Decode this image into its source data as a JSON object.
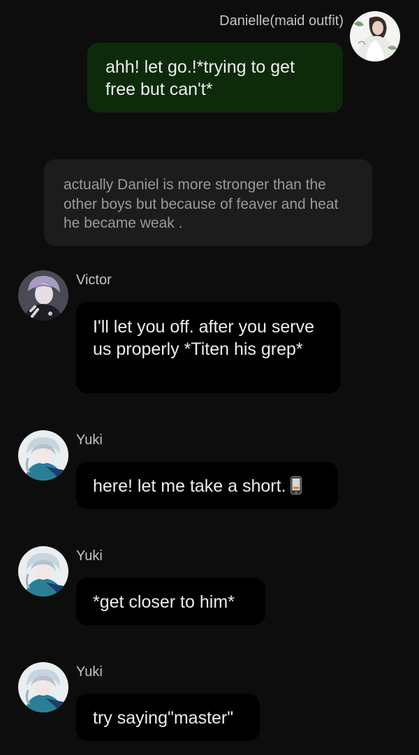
{
  "messages": [
    {
      "sender": "Danielle(maid outfit)",
      "text": "ahh! let go.!*trying to get free but can't*",
      "avatar_icon": "danielle-avatar"
    },
    {
      "type": "narration",
      "text": "actually Daniel is more stronger than the other boys but because of feaver and heat  he became weak ."
    },
    {
      "sender": "Victor",
      "text": "I'll let you off. after you serve us properly *Titen his grep*",
      "avatar_icon": "victor-avatar"
    },
    {
      "sender": "Yuki",
      "text": "here! let me take a short.",
      "emoji": "mobile-phone-icon",
      "avatar_icon": "yuki-avatar"
    },
    {
      "sender": "Yuki",
      "text": "*get closer to him*",
      "avatar_icon": "yuki-avatar"
    },
    {
      "sender": "Yuki",
      "text": "try saying\"master\"",
      "avatar_icon": "yuki-avatar"
    }
  ],
  "colors": {
    "background": "#0d0d0d",
    "user_bubble": "#0d2b0b",
    "character_bubble": "#000000",
    "narration_bubble": "#1c1c1c",
    "narration_text": "#9a9a9a",
    "name_text": "#c4c4c4"
  }
}
